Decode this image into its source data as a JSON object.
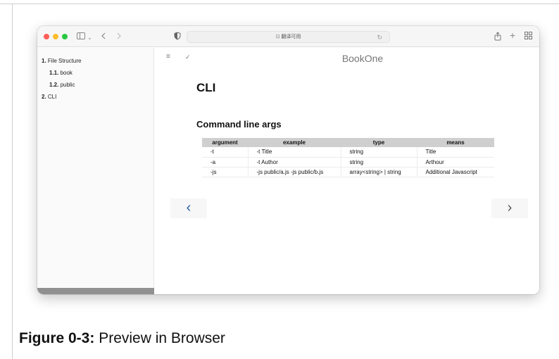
{
  "browser": {
    "address_text": "翻译可用",
    "icons": {
      "sidebar_toggle": "sidebar-icon",
      "back": "chevron-left-icon",
      "forward": "chevron-right-icon",
      "shield": "shield-icon",
      "translate": "translate-icon",
      "reload": "reload-icon",
      "share": "share-icon",
      "new_tab": "plus-icon",
      "tab_overview": "tab-grid-icon"
    },
    "traffic_lights": {
      "close": "#fe5f57",
      "minimize": "#febc2e",
      "zoom": "#28c840"
    }
  },
  "sidebar": {
    "items": [
      {
        "number": "1.",
        "label": "File Structure"
      },
      {
        "number": "1.1.",
        "label": "book"
      },
      {
        "number": "1.2.",
        "label": "public"
      },
      {
        "number": "2.",
        "label": "CLI"
      }
    ]
  },
  "main": {
    "book_title": "BookOne",
    "heading": "CLI",
    "subheading": "Command line args",
    "table": {
      "headers": [
        "argument",
        "example",
        "type",
        "means"
      ],
      "rows": [
        [
          "-t",
          "-t Title",
          "string",
          "Title"
        ],
        [
          "-a",
          "-t Author",
          "string",
          "Arthour"
        ],
        [
          "-js",
          "-js public/a.js -js public/b.js",
          "array<string> | string",
          "Additional Javascript"
        ]
      ]
    },
    "nav": {
      "prev": "‹",
      "next": "›"
    },
    "accent": "#2a5caa"
  },
  "caption": {
    "label": "Figure 0-3:",
    "text": " Preview in Browser"
  }
}
